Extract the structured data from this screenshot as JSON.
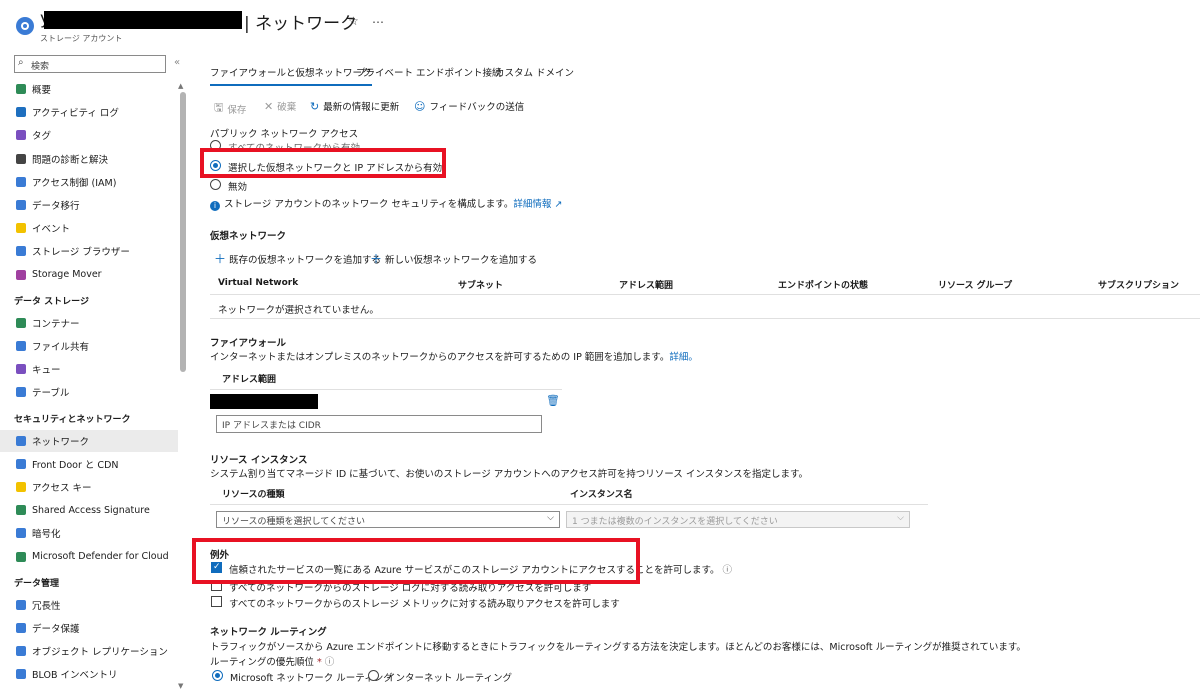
{
  "header": {
    "title_prefix": "y",
    "title": "| ネットワーク",
    "subtitle": "ストレージ アカウント",
    "star": "☆",
    "more": "…"
  },
  "sidebar": {
    "search_placeholder": "検索",
    "collapse": "«",
    "items_top": [
      {
        "label": "概要",
        "icon": "overview-icon",
        "color": "#2e8b57"
      },
      {
        "label": "アクティビティ ログ",
        "icon": "activity-log-icon",
        "color": "#1e6fbf"
      },
      {
        "label": "タグ",
        "icon": "tag-icon",
        "color": "#7a4fbf"
      },
      {
        "label": "問題の診断と解決",
        "icon": "diagnose-icon",
        "color": "#444"
      },
      {
        "label": "アクセス制御 (IAM)",
        "icon": "iam-icon",
        "color": "#3a7bd5"
      },
      {
        "label": "データ移行",
        "icon": "migration-icon",
        "color": "#3a7bd5"
      },
      {
        "label": "イベント",
        "icon": "event-icon",
        "color": "#f2c200"
      },
      {
        "label": "ストレージ ブラウザー",
        "icon": "storage-browser-icon",
        "color": "#3a7bd5"
      },
      {
        "label": "Storage Mover",
        "icon": "storage-mover-icon",
        "color": "#a040a0"
      }
    ],
    "section_data_storage": "データ ストレージ",
    "items_data": [
      {
        "label": "コンテナー",
        "icon": "container-icon",
        "color": "#2e8b57"
      },
      {
        "label": "ファイル共有",
        "icon": "file-share-icon",
        "color": "#3a7bd5"
      },
      {
        "label": "キュー",
        "icon": "queue-icon",
        "color": "#7a4fbf"
      },
      {
        "label": "テーブル",
        "icon": "table-icon",
        "color": "#3a7bd5"
      }
    ],
    "section_security": "セキュリティとネットワーク",
    "items_security": [
      {
        "label": "ネットワーク",
        "icon": "network-icon",
        "color": "#3a7bd5"
      },
      {
        "label": "Front Door と CDN",
        "icon": "frontdoor-icon",
        "color": "#3a7bd5"
      },
      {
        "label": "アクセス キー",
        "icon": "key-icon",
        "color": "#f2c200"
      },
      {
        "label": "Shared Access Signature",
        "icon": "sas-icon",
        "color": "#2e8b57"
      },
      {
        "label": "暗号化",
        "icon": "encryption-icon",
        "color": "#3a7bd5"
      },
      {
        "label": "Microsoft Defender for Cloud",
        "icon": "defender-icon",
        "color": "#2e8b57"
      }
    ],
    "section_data_mgmt": "データ管理",
    "items_mgmt": [
      {
        "label": "冗長性",
        "icon": "redundancy-icon",
        "color": "#3a7bd5"
      },
      {
        "label": "データ保護",
        "icon": "data-protection-icon",
        "color": "#3a7bd5"
      },
      {
        "label": "オブジェクト レプリケーション",
        "icon": "replication-icon",
        "color": "#3a7bd5"
      },
      {
        "label": "BLOB インベントリ",
        "icon": "blob-inventory-icon",
        "color": "#3a7bd5"
      }
    ]
  },
  "tabs": [
    "ファイアウォールと仮想ネットワーク",
    "プライベート エンドポイント接続",
    "カスタム ドメイン"
  ],
  "toolbar": {
    "save": "保存",
    "discard": "破棄",
    "refresh": "最新の情報に更新",
    "feedback": "フィードバックの送信"
  },
  "public_access": {
    "label": "パブリック ネットワーク アクセス",
    "opt_all": "すべてのネットワークから有効",
    "opt_selected": "選択した仮想ネットワークと IP アドレスから有効",
    "opt_disabled": "無効",
    "info": "ストレージ アカウントのネットワーク セキュリティを構成します。",
    "info_link": "詳細情報"
  },
  "vnet": {
    "title": "仮想ネットワーク",
    "add_existing": "既存の仮想ネットワークを追加する",
    "add_new": "新しい仮想ネットワークを追加する",
    "columns": [
      "Virtual Network",
      "サブネット",
      "アドレス範囲",
      "エンドポイントの状態",
      "リソース グループ",
      "サブスクリプション"
    ],
    "empty": "ネットワークが選択されていません。"
  },
  "firewall": {
    "title": "ファイアウォール",
    "desc": "インターネットまたはオンプレミスのネットワークからのアクセスを許可するための IP 範囲を追加します。",
    "desc_link": "詳細。",
    "col": "アドレス範囲",
    "placeholder": "IP アドレスまたは CIDR"
  },
  "resource_instances": {
    "title": "リソース インスタンス",
    "desc": "システム割り当てマネージド ID に基づいて、お使いのストレージ アカウントへのアクセス許可を持つリソース インスタンスを指定します。",
    "col_type": "リソースの種類",
    "col_instance": "インスタンス名",
    "type_placeholder": "リソースの種類を選択してください",
    "instance_placeholder": "1 つまたは複数のインスタンスを選択してください"
  },
  "exceptions": {
    "title": "例外",
    "trusted": "信頼されたサービスの一覧にある Azure サービスがこのストレージ アカウントにアクセスすることを許可します。",
    "logging": "すべてのネットワークからのストレージ ログに対する読み取りアクセスを許可します",
    "metrics": "すべてのネットワークからのストレージ メトリックに対する読み取りアクセスを許可します"
  },
  "routing": {
    "title": "ネットワーク ルーティング",
    "desc": "トラフィックがソースから Azure エンドポイントに移動するときにトラフィックをルーティングする方法を決定します。ほとんどのお客様には、Microsoft ルーティングが推奨されています。",
    "pref_label": "ルーティングの優先順位",
    "required": "*",
    "opt_ms": "Microsoft ネットワーク ルーティング",
    "opt_internet": "インターネット ルーティング"
  }
}
